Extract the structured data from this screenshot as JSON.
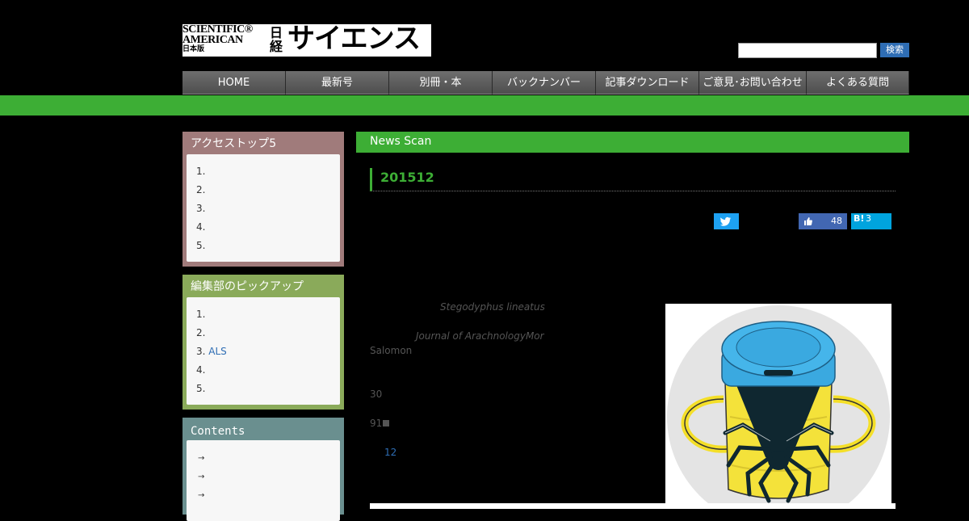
{
  "logo": {
    "line1": "SCIENTIFIC®",
    "line2": "AMERICAN",
    "line3": "日本版",
    "nikkei": "日経",
    "science": "サイエンス"
  },
  "search": {
    "button_label": "検索",
    "value": "",
    "placeholder": ""
  },
  "nav": [
    "HOME",
    "最新号",
    "別冊・本",
    "バックナンバー",
    "記事ダウンロード",
    "ご意見･お問い合わせ",
    "よくある質問"
  ],
  "sidebar": {
    "access_top": {
      "title": "アクセストップ5",
      "items": [
        "1.",
        "2.",
        "3.",
        "4.",
        "5."
      ]
    },
    "picks": {
      "title": "編集部のピックアップ",
      "items": [
        "1.",
        "2.",
        "3.",
        "4.",
        "5."
      ],
      "item3_link": "ALS"
    },
    "contents": {
      "title": "Contents",
      "items": [
        "",
        "",
        ""
      ]
    }
  },
  "main": {
    "section": "News Scan",
    "article_title": "201512",
    "share": {
      "facebook_count": "48",
      "hatena_label": "B!",
      "hatena_count": "3"
    },
    "body": {
      "species": "Stegodyphus lineatus",
      "journal": "Journal of Arachnology",
      "author1": "Mor",
      "author2": "Salomon",
      "num1": "30",
      "num2": "91",
      "num3": "12"
    }
  },
  "colors": {
    "accent_green": "#3dae35",
    "link_blue": "#2e6db4",
    "twitter": "#1da1f2",
    "facebook": "#4267b2",
    "hatena": "#00a4de"
  },
  "icons": [
    "twitter-icon",
    "thumbs-up-icon",
    "arrow-icon"
  ]
}
